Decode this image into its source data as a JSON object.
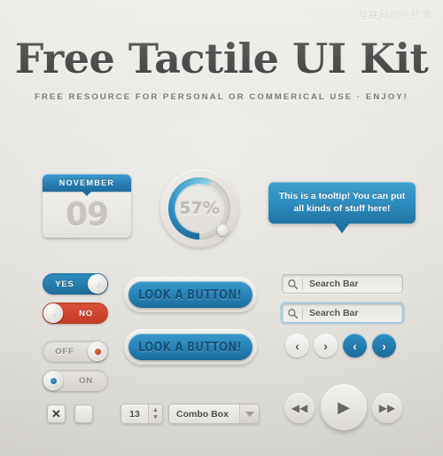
{
  "watermark": "互联网的一些事",
  "header": {
    "title": "Free Tactile UI Kit",
    "subtitle": "FREE RESOURCE FOR PERSONAL OR COMMERICAL USE  ·  ENJOY!"
  },
  "calendar": {
    "month": "NOVEMBER",
    "day": "09"
  },
  "dial": {
    "value": "57%",
    "percent": 57,
    "accent": "#2a87bd"
  },
  "tooltip": {
    "text": "This is a tooltip! You can put all kinds of stuff here!"
  },
  "toggles": [
    {
      "label": "YES",
      "state": "on",
      "color": "#2181b4"
    },
    {
      "label": "NO",
      "state": "off",
      "color": "#cf4229"
    },
    {
      "label": "OFF",
      "state": "off",
      "color": "#e3e0da"
    },
    {
      "label": "ON",
      "state": "on",
      "color": "#e3e0da"
    }
  ],
  "buttons": {
    "primary_label": "LOOK A BUTTON!",
    "secondary_label": "LOOK A BUTTON!"
  },
  "search": {
    "first_value": "Search Bar",
    "second_value": "Search Bar",
    "placeholder": "Search Bar",
    "icon": "search-icon"
  },
  "pager": {
    "prev_light": "‹",
    "next_light": "›",
    "prev_blue": "‹",
    "next_blue": "›"
  },
  "media": {
    "rewind": "◀◀",
    "play": "▶",
    "forward": "▶▶"
  },
  "checkboxes": {
    "checked_mark": "✕",
    "unchecked_mark": ""
  },
  "stepper": {
    "value": "13",
    "up": "▲",
    "down": "▼"
  },
  "combo": {
    "selected": "Combo Box"
  }
}
